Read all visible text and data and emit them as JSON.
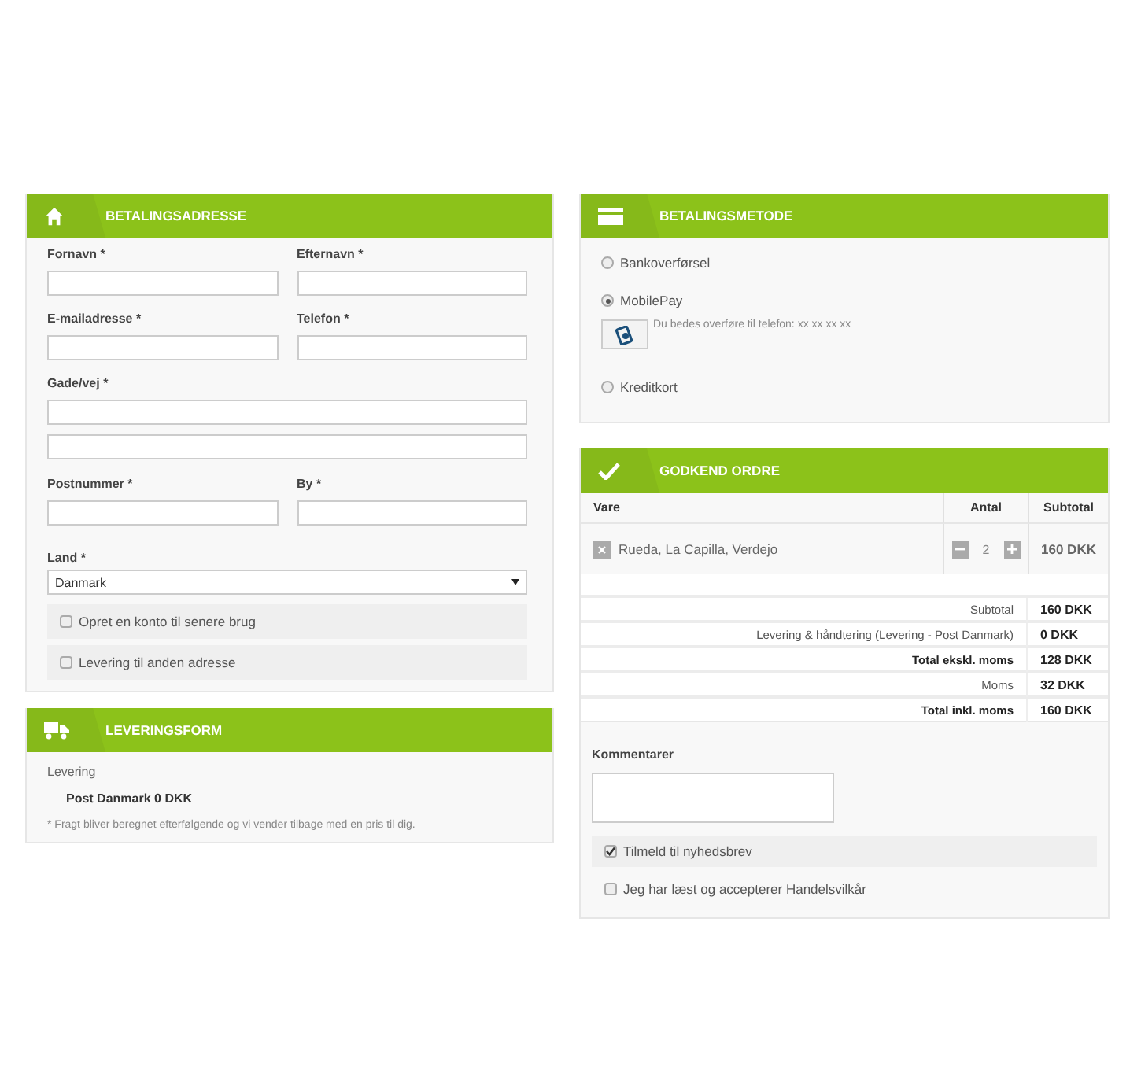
{
  "billing": {
    "title": "BETALINGSADRESSE",
    "rows": [
      [
        {
          "label": "Fornavn *"
        },
        {
          "label": "Efternavn *"
        }
      ],
      [
        {
          "label": "E-mailadresse *"
        },
        {
          "label": "Telefon *"
        }
      ],
      [
        {
          "label": "Gade/vej *"
        }
      ],
      [
        {}
      ],
      [
        {
          "label": "Postnummer *"
        },
        {
          "label": "By *"
        }
      ]
    ],
    "country": {
      "label": "Land *",
      "value": "Danmark"
    },
    "options": [
      {
        "label": "Opret en konto til senere brug",
        "checked": false
      },
      {
        "label": "Levering til anden adresse",
        "checked": false
      }
    ]
  },
  "shipping": {
    "title": "LEVERINGSFORM",
    "label": "Levering",
    "method": "Post Danmark 0 DKK",
    "note": "* Fragt bliver beregnet efterfølgende og vi vender tilbage med en pris til dig."
  },
  "payment": {
    "title": "BETALINGSMETODE",
    "methods": [
      {
        "label": "Bankoverførsel",
        "selected": false
      },
      {
        "label": "MobilePay",
        "selected": true,
        "note": "Du bedes overføre til telefon: xx xx xx xx"
      },
      {
        "label": "Kreditkort",
        "selected": false
      }
    ]
  },
  "order": {
    "title": "GODKEND ORDRE",
    "columns": [
      "Vare",
      "Antal",
      "Subtotal"
    ],
    "items": [
      {
        "name": "Rueda, La Capilla, Verdejo",
        "quantity": "2",
        "subtotal": "160 DKK"
      }
    ],
    "totals": [
      {
        "label": "Subtotal",
        "value": "160 DKK",
        "bold": false
      },
      {
        "label": "Levering & håndtering (Levering - Post Danmark)",
        "value": "0 DKK",
        "bold": false
      },
      {
        "label": "Total ekskl. moms",
        "value": "128 DKK",
        "bold": true
      },
      {
        "label": "Moms",
        "value": "32 DKK",
        "bold": false
      },
      {
        "label": "Total inkl. moms",
        "value": "160 DKK",
        "bold": true
      }
    ],
    "comments_label": "Kommentarer",
    "options": [
      {
        "label": "Tilmeld til nyhedsbrev",
        "checked": true
      },
      {
        "label": "Jeg har læst og accepterer Handelsvilkår",
        "checked": false
      }
    ]
  }
}
